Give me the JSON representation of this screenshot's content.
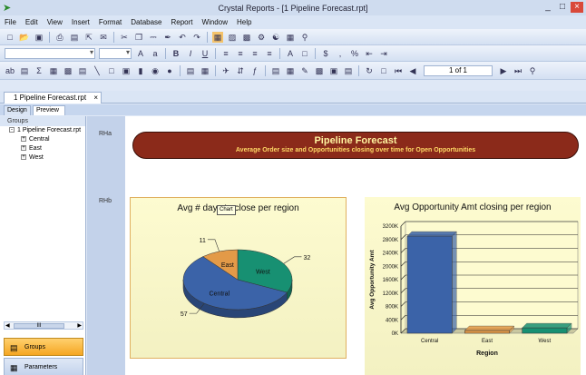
{
  "window": {
    "title": "Crystal Reports - [1 Pipeline Forecast.rpt]",
    "minimize": "_",
    "restore": "□",
    "close": "×"
  },
  "menu": [
    "File",
    "Edit",
    "View",
    "Insert",
    "Format",
    "Database",
    "Report",
    "Window",
    "Help"
  ],
  "navigator": {
    "page": "1 of 1"
  },
  "doc_tab": {
    "label": "1 Pipeline Forecast.rpt",
    "close": "×"
  },
  "view_tabs": [
    "Design",
    "Preview"
  ],
  "view_tab_close": "×",
  "sidebar": {
    "header": "Groups",
    "root": "1 Pipeline Forecast.rpt",
    "groups": [
      "Central",
      "East",
      "West"
    ],
    "expand": "-",
    "collapse": "+",
    "scroll_thumb": "III",
    "btn_groups": "Groups",
    "btn_params": "Parameters"
  },
  "sections": [
    "RHa",
    "RHb"
  ],
  "banner": {
    "title": "Pipeline Forecast",
    "subtitle": "Average Order size and Opportunities closing over time for Open Opportunities"
  },
  "tooltip": "Chart",
  "chart_data": [
    {
      "type": "pie",
      "title": "Avg # days to close per region",
      "categories": [
        "Central",
        "East",
        "West"
      ],
      "values": [
        57,
        11,
        32
      ],
      "colors": {
        "Central": "#3b63a8",
        "East": "#e39a48",
        "West": "#179072"
      }
    },
    {
      "type": "bar",
      "title": "Avg Opportunity Amt closing per region",
      "categories": [
        "Central",
        "East",
        "West"
      ],
      "values": [
        2900000,
        80000,
        160000
      ],
      "xlabel": "Region",
      "ylabel": "Avg Opportunity Amt",
      "ylim": [
        0,
        3200000
      ],
      "yticks": [
        "0K",
        "400K",
        "800K",
        "1200K",
        "1600K",
        "2000K",
        "2400K",
        "2800K",
        "3200K"
      ],
      "colors": [
        "#3b63a8",
        "#e39a48",
        "#179072"
      ]
    }
  ]
}
